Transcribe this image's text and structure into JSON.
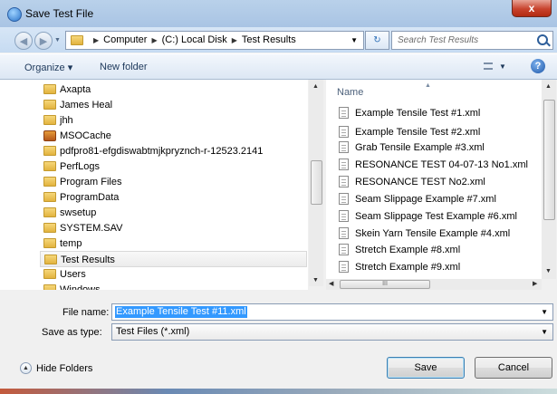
{
  "window": {
    "title": "Save Test File",
    "close_glyph": "x"
  },
  "address": {
    "crumbs": [
      "Computer",
      "(C:) Local Disk",
      "Test Results"
    ],
    "search_placeholder": "Search Test Results"
  },
  "toolbar": {
    "organize_label": "Organize ▾",
    "new_folder_label": "New folder"
  },
  "nav_pane": {
    "items": [
      {
        "label": "Axapta",
        "icon": "folder-icon"
      },
      {
        "label": "James Heal",
        "icon": "folder-icon"
      },
      {
        "label": "jhh",
        "icon": "folder-icon"
      },
      {
        "label": "MSOCache",
        "icon": "special-folder-icon"
      },
      {
        "label": "pdfpro81-efgdiswabtmjkpryznch-r-12523.2141",
        "icon": "folder-icon"
      },
      {
        "label": "PerfLogs",
        "icon": "folder-icon"
      },
      {
        "label": "Program Files",
        "icon": "folder-icon"
      },
      {
        "label": "ProgramData",
        "icon": "folder-icon"
      },
      {
        "label": "swsetup",
        "icon": "folder-icon"
      },
      {
        "label": "SYSTEM.SAV",
        "icon": "folder-icon"
      },
      {
        "label": "temp",
        "icon": "folder-icon"
      },
      {
        "label": "Test Results",
        "icon": "folder-icon",
        "selected": true
      },
      {
        "label": "Users",
        "icon": "folder-icon"
      },
      {
        "label": "Windows",
        "icon": "folder-icon"
      }
    ]
  },
  "file_list": {
    "column_header": "Name",
    "files": [
      "Example Tensile Test #1.xml",
      "Example Tensile Test #2.xml",
      "Grab Tensile Example #3.xml",
      "RESONANCE TEST 04-07-13 No1.xml",
      "RESONANCE TEST No2.xml",
      "Seam Slippage Example #7.xml",
      "Seam Slippage Test Example #6.xml",
      "Skein Yarn Tensile Example #4.xml",
      "Stretch Example #8.xml",
      "Stretch Example #9.xml"
    ]
  },
  "form": {
    "file_name_label": "File name:",
    "file_name_value": "Example Tensile Test #11.xml",
    "save_as_type_label": "Save as type:",
    "save_as_type_value": "Test Files (*.xml)"
  },
  "footer": {
    "hide_folders_label": "Hide Folders",
    "save_label": "Save",
    "cancel_label": "Cancel"
  },
  "scroll": {
    "hthumb_grip": "III"
  },
  "colors": {
    "selection": "#3399ff",
    "folder": "#e2b33e",
    "titlebar": "#b9d1ea"
  }
}
